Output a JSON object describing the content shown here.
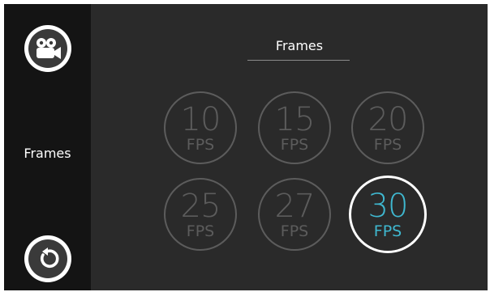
{
  "sidebar": {
    "camera_button_icon": "video-camera-icon",
    "label": "Frames",
    "back_button_icon": "rotate-back-icon"
  },
  "header": {
    "title": "Frames"
  },
  "options": [
    {
      "value": "10",
      "unit": "FPS",
      "selected": false
    },
    {
      "value": "15",
      "unit": "FPS",
      "selected": false
    },
    {
      "value": "20",
      "unit": "FPS",
      "selected": false
    },
    {
      "value": "25",
      "unit": "FPS",
      "selected": false
    },
    {
      "value": "27",
      "unit": "FPS",
      "selected": false
    },
    {
      "value": "30",
      "unit": "FPS",
      "selected": true
    }
  ],
  "colors": {
    "background": "#2a2a2a",
    "sidebar": "#141414",
    "inactive": "#5c5c5c",
    "accent": "#3fb8d0",
    "selected_ring": "#ffffff"
  }
}
